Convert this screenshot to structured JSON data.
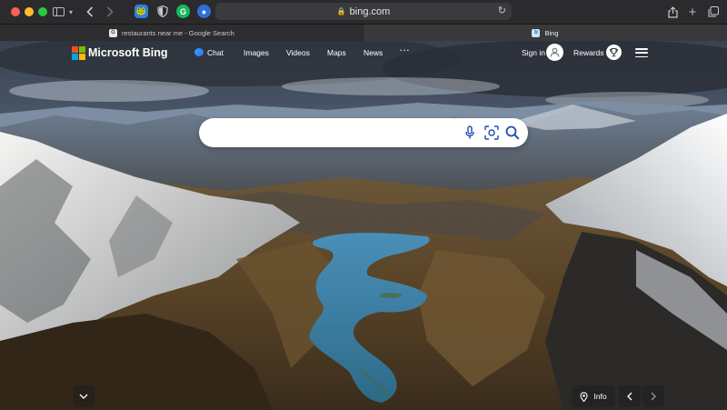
{
  "browser": {
    "address": "bing.com",
    "tabs": [
      {
        "title": "restaurants near me - Google Search",
        "favicon": "G"
      },
      {
        "title": "Bing",
        "favicon": "b"
      }
    ]
  },
  "bing": {
    "logo_text": "Microsoft Bing",
    "nav": [
      "Chat",
      "Images",
      "Videos",
      "Maps",
      "News",
      "···"
    ],
    "sign_in": "Sign in",
    "rewards": "Rewards",
    "info_label": "Info",
    "search_placeholder": ""
  },
  "colors": {
    "ms_red": "#f25022",
    "ms_green": "#7fba00",
    "ms_blue": "#00a4ef",
    "ms_yellow": "#ffb900",
    "toolbar": "#2b2b2d"
  }
}
